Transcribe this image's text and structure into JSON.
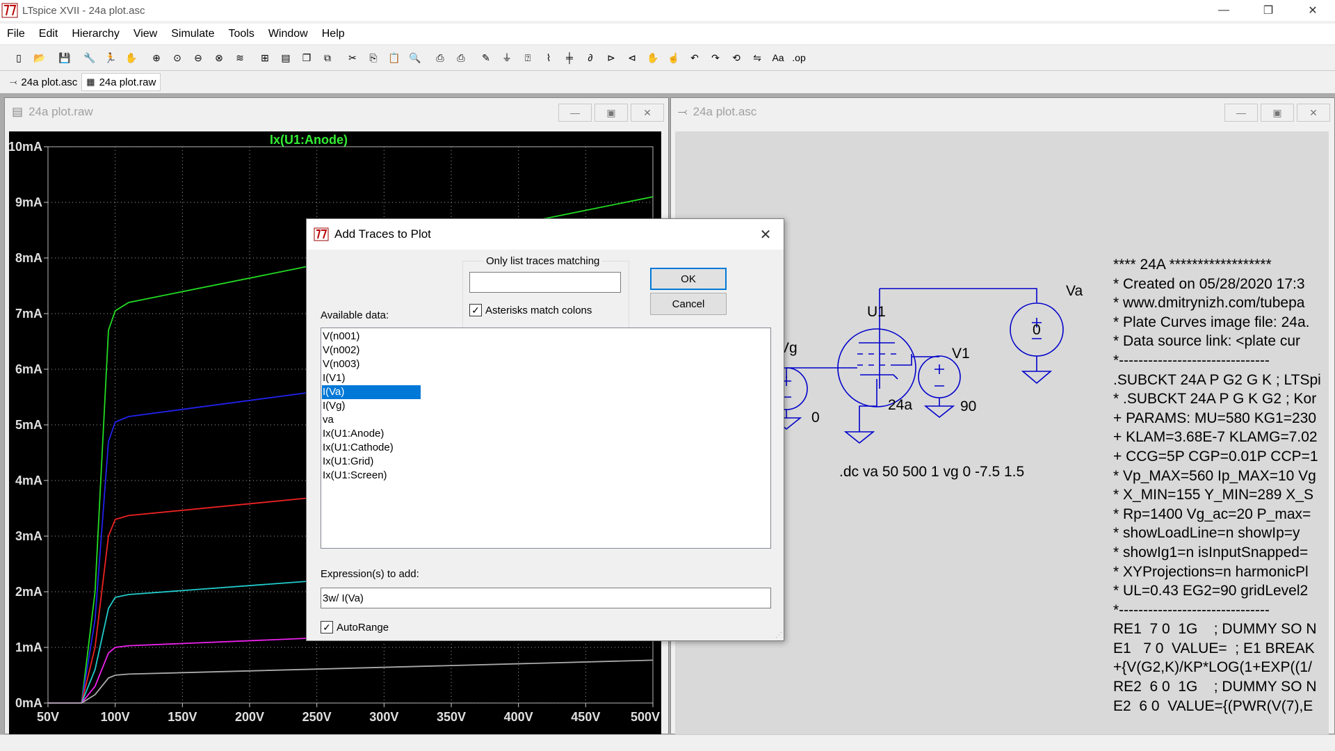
{
  "window": {
    "title": "LTspice XVII - 24a plot.asc",
    "minimize": "—",
    "maximize": "❐",
    "close": "✕"
  },
  "menu": [
    "File",
    "Edit",
    "Hierarchy",
    "View",
    "Simulate",
    "Tools",
    "Window",
    "Help"
  ],
  "toolbar_icons": [
    "new-schematic-icon",
    "open-icon",
    "save-icon",
    "control-panel-icon",
    "run-icon",
    "halt-icon",
    "zoom-in-icon",
    "zoom-pan-icon",
    "zoom-out-icon",
    "zoom-fit-icon",
    "autorange-icon",
    "grid-icon",
    "tile-icon",
    "cascade-icon",
    "close-all-icon",
    "cut-icon",
    "copy-icon",
    "paste-icon",
    "find-icon",
    "print-icon",
    "print-setup-icon",
    "draw-wire-icon",
    "ground-icon",
    "label-net-icon",
    "resistor-icon",
    "capacitor-icon",
    "inductor-icon",
    "diode-icon",
    "component-icon",
    "move-icon",
    "drag-icon",
    "undo-icon",
    "redo-icon",
    "rotate-icon",
    "mirror-icon",
    "text-icon",
    "spice-directive-icon"
  ],
  "tabs": [
    {
      "label": "24a plot.asc",
      "icon": "schematic-icon"
    },
    {
      "label": "24a plot.raw",
      "icon": "waveform-icon"
    }
  ],
  "plot_window": {
    "title": "24a plot.raw"
  },
  "schematic_window": {
    "title": "24a plot.asc"
  },
  "chart_data": {
    "type": "line",
    "title": "Ix(U1:Anode)",
    "xlabel": "",
    "ylabel": "",
    "xlim": [
      50,
      500
    ],
    "ylim": [
      0,
      10
    ],
    "x_ticks": [
      "50V",
      "100V",
      "150V",
      "200V",
      "250V",
      "300V",
      "350V",
      "400V",
      "450V",
      "500V"
    ],
    "y_ticks": [
      "0mA",
      "1mA",
      "2mA",
      "3mA",
      "4mA",
      "5mA",
      "6mA",
      "7mA",
      "8mA",
      "9mA",
      "10mA"
    ],
    "grid": true,
    "series": [
      {
        "color": "#22dd22",
        "x": [
          50,
          75,
          85,
          95,
          100,
          110,
          500
        ],
        "y": [
          0,
          0,
          2,
          6.7,
          7.05,
          7.2,
          9.1
        ]
      },
      {
        "color": "#2222ee",
        "x": [
          50,
          75,
          85,
          95,
          100,
          110,
          250
        ],
        "y": [
          0,
          0,
          1.5,
          4.7,
          5.05,
          5.15,
          5.6
        ]
      },
      {
        "color": "#ee2222",
        "x": [
          50,
          75,
          85,
          95,
          100,
          110,
          250
        ],
        "y": [
          0,
          0,
          1,
          3.0,
          3.3,
          3.37,
          3.7
        ]
      },
      {
        "color": "#22cccc",
        "x": [
          50,
          75,
          85,
          95,
          100,
          110,
          250
        ],
        "y": [
          0,
          0,
          0.6,
          1.7,
          1.9,
          1.95,
          2.2
        ]
      },
      {
        "color": "#ee22ee",
        "x": [
          50,
          75,
          85,
          95,
          100,
          110,
          250
        ],
        "y": [
          0,
          0,
          0.3,
          0.9,
          1.0,
          1.03,
          1.17
        ]
      },
      {
        "color": "#aaaaaa",
        "x": [
          50,
          75,
          85,
          95,
          100,
          110,
          500
        ],
        "y": [
          0,
          0,
          0.15,
          0.45,
          0.5,
          0.52,
          0.77
        ]
      }
    ]
  },
  "schematic": {
    "labels": {
      "va": "Va",
      "va_value": "0",
      "u1": "U1",
      "u1_model": "24a",
      "vg": "Vg",
      "vg_value": "0",
      "v1": "V1",
      "v1_value": "90"
    },
    "directive": ".dc va 50 500 1 vg 0 -7.5 1.5",
    "netlist": [
      "**** 24A ******************",
      "* Created on 05/28/2020 17:3",
      "* www.dmitrynizh.com/tubepa",
      "* Plate Curves image file: 24a.",
      "* Data source link: <plate cur",
      "*-------------------------------",
      ".SUBCKT 24A P G2 G K ; LTSpi",
      "* .SUBCKT 24A P G K G2 ; Kor",
      "+ PARAMS: MU=580 KG1=230",
      "+ KLAM=3.68E-7 KLAMG=7.02",
      "+ CCG=5P CGP=0.01P CCP=1",
      "* Vp_MAX=560 Ip_MAX=10 Vg",
      "* X_MIN=155 Y_MIN=289 X_S",
      "* Rp=1400 Vg_ac=20 P_max=",
      "* showLoadLine=n showIp=y",
      "* showIg1=n isInputSnapped=",
      "* XYProjections=n harmonicPl",
      "* UL=0.43 EG2=90 gridLevel2",
      "*-------------------------------",
      "RE1  7 0  1G    ; DUMMY SO N",
      "E1   7 0  VALUE=  ; E1 BREAK",
      "+{V(G2,K)/KP*LOG(1+EXP((1/",
      "RE2  6 0  1G    ; DUMMY SO N",
      "E2  6 0  VALUE={(PWR(V(7),E"
    ]
  },
  "dialog": {
    "title": "Add Traces to Plot",
    "close": "✕",
    "filter_group_label": "Only list traces matching",
    "filter_value": "",
    "asterisks_label": "Asterisks match colons",
    "asterisks_checked": true,
    "available_label": "Available data:",
    "traces": [
      "V(n001)",
      "V(n002)",
      "V(n003)",
      "I(V1)",
      "I(Va)",
      "I(Vg)",
      "va",
      "Ix(U1:Anode)",
      "Ix(U1:Cathode)",
      "Ix(U1:Grid)",
      "Ix(U1:Screen)"
    ],
    "selected_trace": "I(Va)",
    "ok_label": "OK",
    "cancel_label": "Cancel",
    "expression_label": "Expression(s) to add:",
    "expression_value": "3w/ I(Va)",
    "autorange_label": "AutoRange",
    "autorange_checked": true
  }
}
